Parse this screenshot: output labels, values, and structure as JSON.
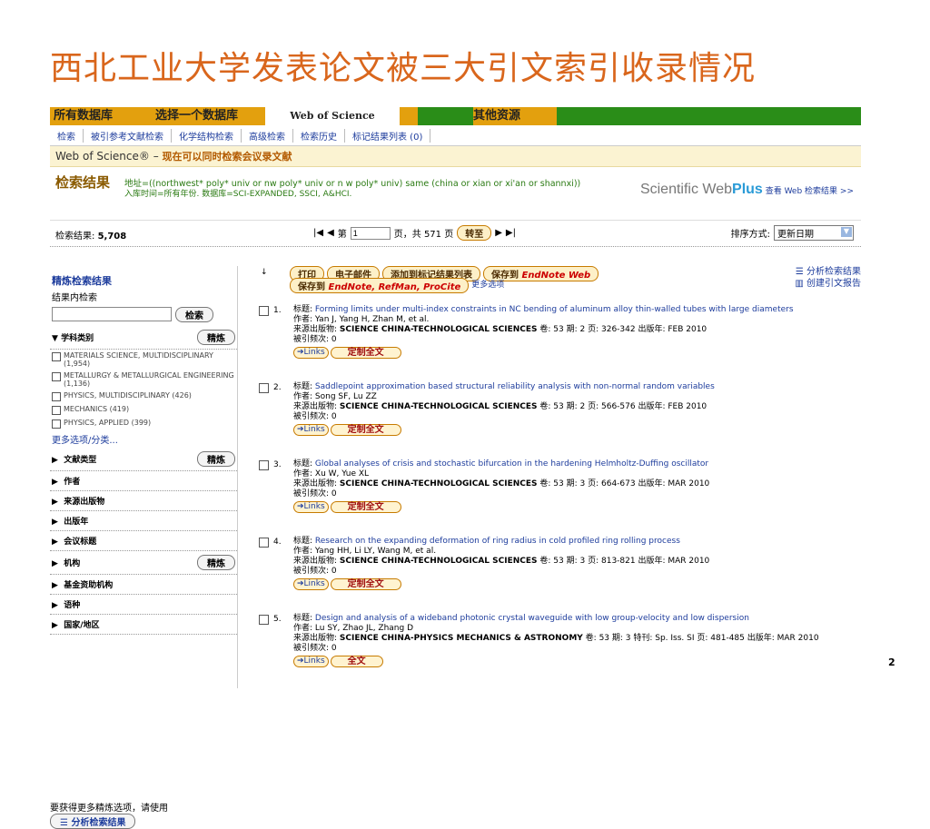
{
  "slide_title": "西北工业大学发表论文被三大引文索引收录情况",
  "page_number": "2",
  "tabs": [
    "所有数据库",
    "选择一个数据库",
    "Web of Science",
    "其他资源"
  ],
  "subnav": [
    "检索",
    "被引参考文献检索",
    "化学结构检索",
    "高级检索",
    "检索历史",
    "标记结果列表 (0)"
  ],
  "banner": {
    "product": "Web of Science®",
    "sep": " – ",
    "text": "现在可以同时检索会议录文献"
  },
  "results": {
    "label": "检索结果",
    "query1": "地址=((northwest* poly* univ or nw poly* univ or n w poly* univ) same (china or xian or xi'an or shannxi))",
    "query2": "入库时间=所有年份. 数据库=SCI-EXPANDED, SSCI, A&HCI.",
    "brand_plain": "Scientific Web",
    "brand_bold": "Plus",
    "brand_link": "查看 Web 检索结果 >>"
  },
  "countbar": {
    "label": "检索结果:",
    "count": "5,708",
    "page_prefix": "第",
    "page_value": "1",
    "page_suffix": "页，共 571 页",
    "goto": "转至",
    "sort_label": "排序方式:",
    "sort_value": "更新日期"
  },
  "left": {
    "refine_title": "精炼检索结果",
    "within_label": "结果内检索",
    "search_btn": "检索",
    "subject_label": "学科类别",
    "refine_btn": "精炼",
    "subjects": [
      "MATERIALS SCIENCE, MULTIDISCIPLINARY (1,954)",
      "METALLURGY & METALLURGICAL ENGINEERING (1,136)",
      "PHYSICS, MULTIDISCIPLINARY (426)",
      "MECHANICS (419)",
      "PHYSICS, APPLIED (399)"
    ],
    "more_options": "更多选项/分类...",
    "sections": [
      "文献类型",
      "作者",
      "来源出版物",
      "出版年",
      "会议标题",
      "机构",
      "基金资助机构",
      "语种",
      "国家/地区"
    ],
    "foot_text": "要获得更多精炼选项，请使用",
    "analyze_btn": "分析检索结果"
  },
  "toolbar": {
    "row1": [
      "打印",
      "电子邮件",
      "添加到标记结果列表",
      "保存到"
    ],
    "endnote_web": "EndNote Web",
    "row2_prefix": "保存到",
    "row2_targets": "EndNote, RefMan, ProCite",
    "more_options": "更多选项",
    "analyze": "分析检索结果",
    "citation_report": "创建引文报告"
  },
  "record_labels": {
    "title": "标题:",
    "author": "作者:",
    "source": "来源出版物:",
    "cited": "被引频次:",
    "links": "Links",
    "fulltext": "定制全文",
    "fulltext_alt": "全文"
  },
  "records": [
    {
      "num": "1.",
      "title": "Forming limits under multi-index constraints in NC bending of aluminum alloy thin-walled tubes with large diameters",
      "authors": "Yan J, Yang H, Zhan M, et al.",
      "source": "SCIENCE CHINA-TECHNOLOGICAL SCIENCES",
      "detail": "卷: 53  期: 2  页: 326-342  出版年: FEB 2010",
      "cited": "0",
      "fulltext": "定制全文"
    },
    {
      "num": "2.",
      "title": "Saddlepoint approximation based structural reliability analysis with non-normal random variables",
      "authors": "Song SF, Lu ZZ",
      "source": "SCIENCE CHINA-TECHNOLOGICAL SCIENCES",
      "detail": "卷: 53  期: 2  页: 566-576  出版年: FEB 2010",
      "cited": "0",
      "fulltext": "定制全文"
    },
    {
      "num": "3.",
      "title": "Global analyses of crisis and stochastic bifurcation in the hardening Helmholtz-Duffing oscillator",
      "authors": "Xu W, Yue XL",
      "source": "SCIENCE CHINA-TECHNOLOGICAL SCIENCES",
      "detail": "卷: 53  期: 3  页: 664-673  出版年: MAR 2010",
      "cited": "0",
      "fulltext": "定制全文"
    },
    {
      "num": "4.",
      "title": "Research on the expanding deformation of ring radius in cold profiled ring rolling process",
      "authors": "Yang HH, Li LY, Wang M, et al.",
      "source": "SCIENCE CHINA-TECHNOLOGICAL SCIENCES",
      "detail": "卷: 53  期: 3  页: 813-821  出版年: MAR 2010",
      "cited": "0",
      "fulltext": "定制全文"
    },
    {
      "num": "5.",
      "title": "Design and analysis of a wideband photonic crystal waveguide with low group-velocity and low dispersion",
      "authors": "Lu SY, Zhao JL, Zhang D",
      "source": "SCIENCE CHINA-PHYSICS MECHANICS & ASTRONOMY",
      "detail": "卷: 53  期: 3  特刊: Sp. Iss. SI  页: 481-485  出版年: MAR 2010",
      "cited": "0",
      "fulltext": "全文"
    }
  ]
}
